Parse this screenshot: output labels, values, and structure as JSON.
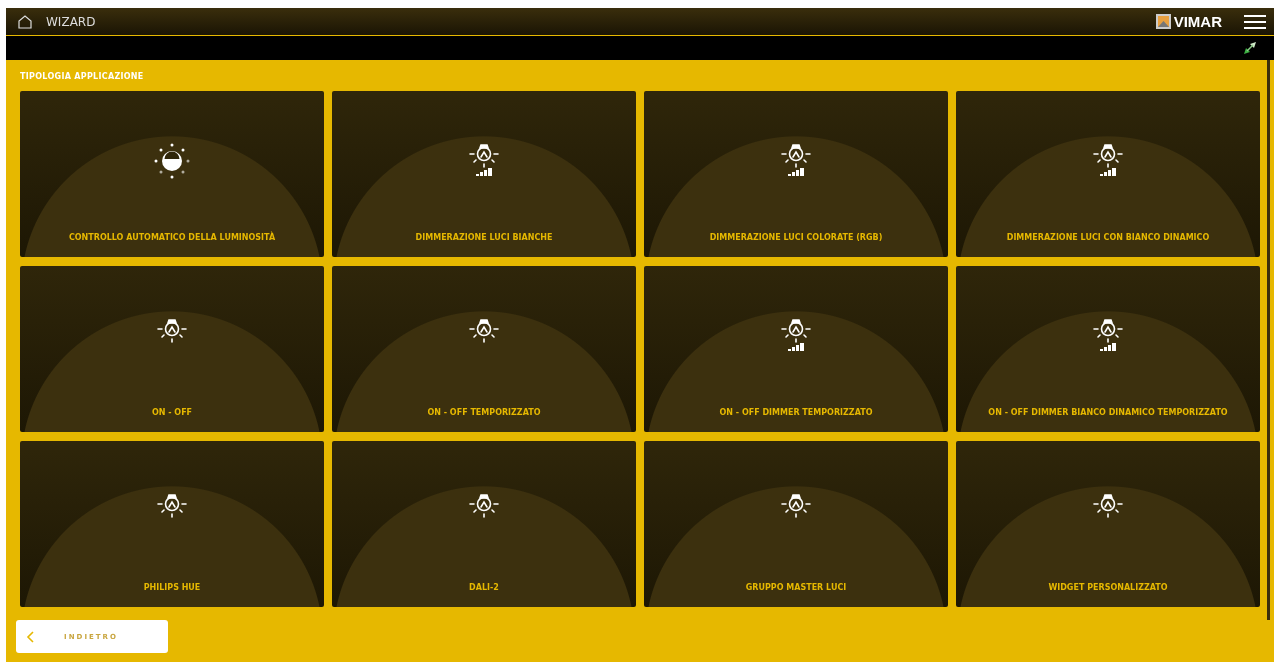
{
  "header": {
    "title": "WIZARD",
    "brand": "VIMAR"
  },
  "section_title": "TIPOLOGIA APPLICAZIONE",
  "tiles": [
    {
      "label": "CONTROLLO AUTOMATICO DELLA LUMINOSITÀ",
      "kind": "brightness"
    },
    {
      "label": "DIMMERAZIONE LUCI BIANCHE",
      "kind": "dimmer"
    },
    {
      "label": "DIMMERAZIONE LUCI COLORATE (RGB)",
      "kind": "dimmer"
    },
    {
      "label": "DIMMERAZIONE LUCI CON BIANCO DINAMICO",
      "kind": "dimmer"
    },
    {
      "label": "ON - OFF",
      "kind": "bulb"
    },
    {
      "label": "ON - OFF TEMPORIZZATO",
      "kind": "bulb"
    },
    {
      "label": "ON - OFF DIMMER TEMPORIZZATO",
      "kind": "dimmer"
    },
    {
      "label": "ON - OFF DIMMER BIANCO DINAMICO TEMPORIZZATO",
      "kind": "dimmer"
    },
    {
      "label": "PHILIPS HUE",
      "kind": "bulb"
    },
    {
      "label": "DALI-2",
      "kind": "bulb"
    },
    {
      "label": "GRUPPO MASTER LUCI",
      "kind": "bulb"
    },
    {
      "label": "WIDGET PERSONALIZZATO",
      "kind": "bulb"
    }
  ],
  "back_button": {
    "label": "INDIETRO"
  }
}
